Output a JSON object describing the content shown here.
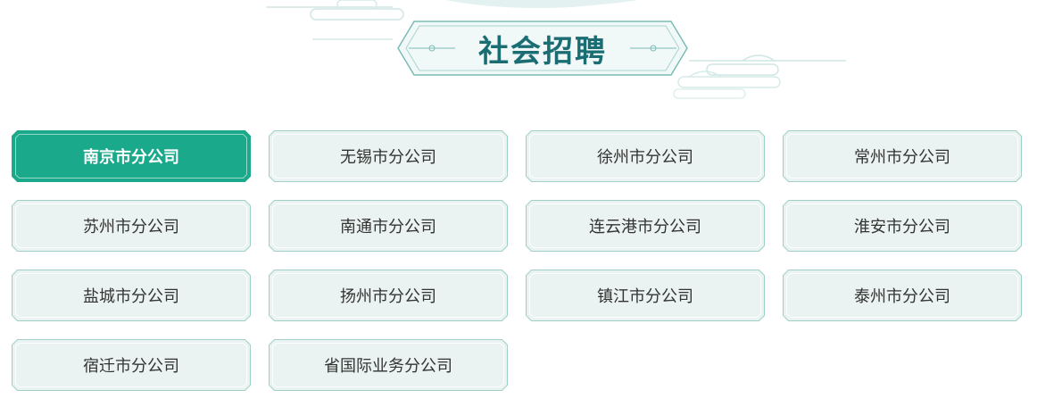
{
  "section": {
    "title": "社会招聘"
  },
  "branches": [
    {
      "label": "南京市分公司",
      "active": true
    },
    {
      "label": "无锡市分公司",
      "active": false
    },
    {
      "label": "徐州市分公司",
      "active": false
    },
    {
      "label": "常州市分公司",
      "active": false
    },
    {
      "label": "苏州市分公司",
      "active": false
    },
    {
      "label": "南通市分公司",
      "active": false
    },
    {
      "label": "连云港市分公司",
      "active": false
    },
    {
      "label": "淮安市分公司",
      "active": false
    },
    {
      "label": "盐城市分公司",
      "active": false
    },
    {
      "label": "扬州市分公司",
      "active": false
    },
    {
      "label": "镇江市分公司",
      "active": false
    },
    {
      "label": "泰州市分公司",
      "active": false
    },
    {
      "label": "宿迁市分公司",
      "active": false
    },
    {
      "label": "省国际业务分公司",
      "active": false
    }
  ],
  "colors": {
    "active_fill": "#1aa98a",
    "inactive_fill": "#eaf3f1",
    "border": "#9fcfc6",
    "title": "#1a6e73"
  }
}
